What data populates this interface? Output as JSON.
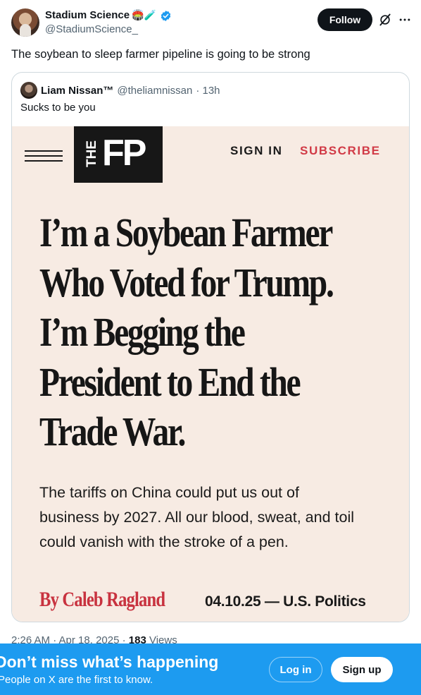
{
  "post": {
    "author": {
      "display_name": "Stadium Science",
      "emojis": "🏟️🧪",
      "handle": "@StadiumScience_",
      "verified": true
    },
    "follow_label": "Follow",
    "text": "The soybean to sleep farmer pipeline is going to be strong",
    "timestamp": "2:26 AM · Apr 18, 2025 · ",
    "views_count": "183",
    "views_label": " Views"
  },
  "quote": {
    "author_name": "Liam Nissan™",
    "author_handle": "@theliamnissan",
    "age": "· 13h",
    "text": "Sucks to be you",
    "article": {
      "logo_the": "THE",
      "logo_fp": "FP",
      "sign_in": "SIGN IN",
      "subscribe": "SUBSCRIBE",
      "headline_lines": [
        "I’m a Soybean Farmer",
        "Who Voted for Trump.",
        "I’m Begging the",
        "President to End the",
        "Trade War."
      ],
      "dek_lines": [
        "The tariffs on China could put us out of",
        "business by 2027. All our blood, sweat, and toil",
        "could vanish with the stroke of a pen."
      ],
      "byline": "By Caleb Ragland",
      "dateline": "04.10.25 — U.S. Politics"
    }
  },
  "banner": {
    "title": "Don’t miss what’s happening",
    "subtitle": "People on X are the first to know.",
    "login_label": "Log in",
    "signup_label": "Sign up"
  },
  "colors": {
    "accent": "#1d9bf0",
    "subscribe_red": "#d13a46",
    "byline_red": "#c8323f",
    "article_bg": "#f7ebe3"
  }
}
